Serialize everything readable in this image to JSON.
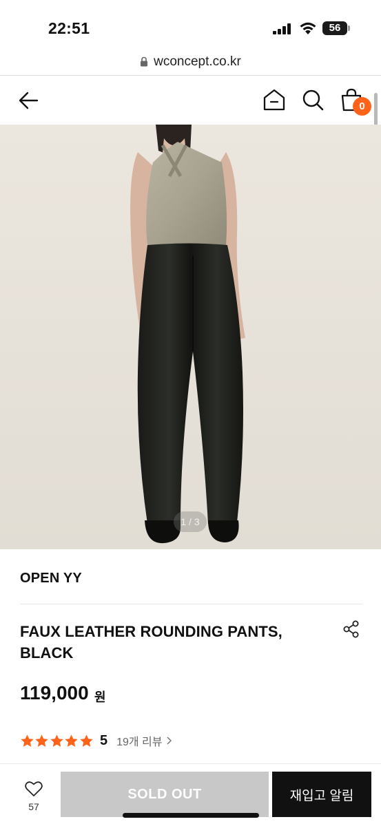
{
  "status_bar": {
    "time": "22:51",
    "battery": "56",
    "icons": [
      "signal-icon",
      "wifi-icon",
      "battery-icon"
    ]
  },
  "browser": {
    "url": "wconcept.co.kr"
  },
  "header": {
    "icons": [
      "back-arrow-icon",
      "home-icon",
      "search-icon",
      "cart-icon"
    ],
    "cart_count": "0",
    "accent_color": "#ff6319"
  },
  "product": {
    "image_counter": "1 / 3",
    "brand": "OPEN YY",
    "title": "FAUX LEATHER ROUNDING PANTS, BLACK",
    "price": "119,000",
    "currency": "원",
    "rating": {
      "stars": 5,
      "value": "5",
      "reviews": "19개 리뷰",
      "star_color": "#ff6319"
    }
  },
  "bottom_bar": {
    "wish_count": "57",
    "sold_out_label": "SOLD OUT",
    "restock_label": "재입고 알림"
  }
}
